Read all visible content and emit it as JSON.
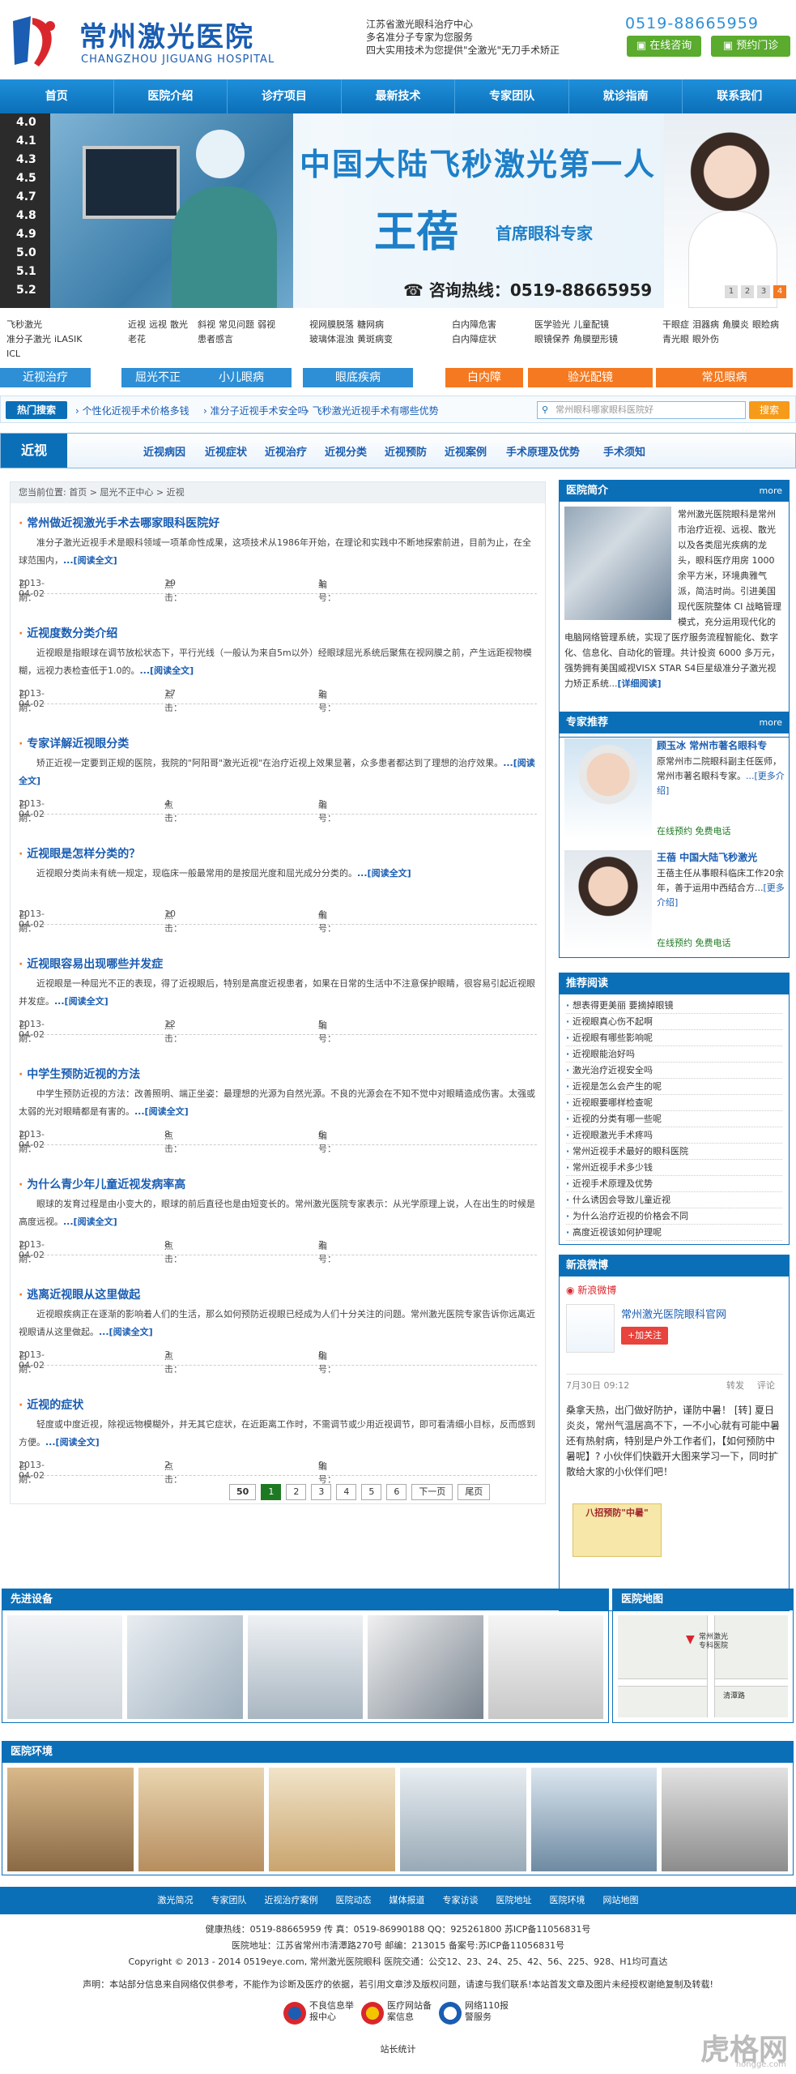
{
  "header": {
    "logo_cn": "常州激光医院",
    "logo_en": "CHANGZHOU JIGUANG HOSPITAL",
    "slogan": [
      "江苏省激光眼科治疗中心",
      "多名准分子专家为您服务",
      "四大实用技术为您提供\"全激光\"无刀手术矫正"
    ],
    "phone": "0519-88665959",
    "btn_consult": "在线咨询",
    "btn_booking": "预约门诊"
  },
  "nav": [
    "首页",
    "医院介绍",
    "诊疗项目",
    "最新技术",
    "专家团队",
    "就诊指南",
    "联系我们"
  ],
  "banner": {
    "eye_chart": [
      "4.0",
      "4.1",
      "4.3",
      "4.5",
      "4.7",
      "4.8",
      "4.9",
      "5.0",
      "5.1",
      "5.2"
    ],
    "headline": "中国大陆飞秒激光第一人",
    "name": "王蓓",
    "title": "首席眼科专家",
    "hotline": "咨询热线：0519-88665959",
    "dots": [
      "1",
      "2",
      "3",
      "4"
    ]
  },
  "categories": [
    {
      "links": [
        "飞秒激光",
        "准分子激光",
        "iLASIK",
        "ICL"
      ],
      "footer": "近视治疗",
      "color": "#2e8fd6"
    },
    {
      "links": [
        "近视",
        "远视",
        "散光",
        "老花"
      ],
      "footer": "屈光不正",
      "color": "#2e8fd6"
    },
    {
      "links": [
        "斜视",
        "常见问题",
        "弱视",
        "患者感言"
      ],
      "footer": "小儿眼病",
      "color": "#2e8fd6"
    },
    {
      "links": [
        "视网膜脱落",
        "糖网病",
        "玻璃体混浊",
        "黄斑病变"
      ],
      "footer": "眼底疾病",
      "color": "#2e8fd6"
    },
    {
      "links": [
        "白内障危害",
        "白内障症状"
      ],
      "footer": "白内障",
      "color": "#f47920"
    },
    {
      "links": [
        "医学验光",
        "儿童配镜",
        "眼镜保养",
        "角膜塑形镜"
      ],
      "footer": "验光配镜",
      "color": "#f47920"
    },
    {
      "links": [
        "干眼症",
        "泪器病",
        "角膜炎",
        "眼睑病",
        "青光眼",
        "眼外伤"
      ],
      "footer": "常见眼病",
      "color": "#f47920"
    }
  ],
  "hot": {
    "label": "热门搜索",
    "links": [
      "个性化近视手术价格多钱",
      "准分子近视手术安全吗",
      "飞秒激光近视手术有哪些优势"
    ],
    "placeholder": "常州眼科哪家眼科医院好",
    "btn": "搜索"
  },
  "subnav": {
    "title": "近视",
    "items": [
      "近视病因",
      "近视症状",
      "近视治疗",
      "近视分类",
      "近视预防",
      "近视案例",
      "手术原理及优势",
      "手术须知"
    ]
  },
  "breadcrumb": "您当前位置: 首页 > 屈光不正中心 > 近视",
  "labels": {
    "date": "日期：",
    "views": "点击：",
    "id": "编号：",
    "read": "...[阅读全文]"
  },
  "articles": [
    {
      "title": "常州做近视激光手术去哪家眼科医院好",
      "summary": "准分子激光近视手术是眼科领域一项革命性成果，这项技术从1986年开始，在理论和实践中不断地探索前进，目前为止，在全球范围内，",
      "date": "2013-04-02",
      "views": "19",
      "id": "1"
    },
    {
      "title": "近视度数分类介绍",
      "summary": "近视眼是指眼球在调节放松状态下，平行光线（一般认为来自5m以外）经眼球屈光系统后聚焦在视网膜之前，产生远距视物模糊，远视力表检查低于1.0的。",
      "date": "2013-04-02",
      "views": "17",
      "id": "2"
    },
    {
      "title": "专家详解近视眼分类",
      "summary": "矫正近视一定要到正规的医院，我院的\"阿阳哥\"激光近视\"在治疗近视上效果显著，众多患者都达到了理想的治疗效果。",
      "date": "2013-04-02",
      "views": "4",
      "id": "3"
    },
    {
      "title": "近视眼是怎样分类的？",
      "summary": "近视眼分类尚未有统一规定，现临床一般最常用的是按屈光度和屈光成分分类的。",
      "date": "2013-04-02",
      "views": "10",
      "id": "4"
    },
    {
      "title": "近视眼容易出现哪些并发症",
      "summary": "近视眼是一种屈光不正的表现，得了近视眼后，特别是高度近视患者，如果在日常的生活中不注意保护眼睛，很容易引起近视眼并发症。",
      "date": "2013-04-02",
      "views": "12",
      "id": "5"
    },
    {
      "title": "中学生预防近视的方法",
      "summary": "中学生预防近视的方法：改善照明、端正坐姿：最理想的光源为自然光源。不良的光源会在不知不觉中对眼睛造成伤害。太强或太弱的光对眼睛都是有害的。",
      "date": "2013-04-02",
      "views": "8",
      "id": "6"
    },
    {
      "title": "为什么青少年儿童近视发病率高",
      "summary": "眼球的发育过程是由小变大的，眼球的前后直径也是由短变长的。常州激光医院专家表示：从光学原理上说，人在出生的时候是高度远视。",
      "date": "2013-04-02",
      "views": "8",
      "id": "7"
    },
    {
      "title": "逃离近视眼从这里做起",
      "summary": "近视眼疾病正在逐渐的影响着人们的生活，那么如何预防近视眼已经成为人们十分关注的问题。常州激光医院专家告诉你远离近视眼请从这里做起。",
      "date": "2013-04-02",
      "views": "3",
      "id": "8"
    },
    {
      "title": "近视的症状",
      "summary": "轻度或中度近视，除视远物模糊外，并无其它症状，在近距离工作时，不需调节或少用近视调节，即可看清细小目标，反而感到方便。",
      "date": "2013-04-02",
      "views": "2",
      "id": "9"
    }
  ],
  "pager": [
    "50",
    "1",
    "2",
    "3",
    "4",
    "5",
    "6",
    "下一页",
    "尾页"
  ],
  "sidebar": {
    "intro_title": "医院简介",
    "more": "more",
    "intro_text": "常州激光医院眼科是常州市治疗近视、远视、散光以及各类屈光疾病的龙头，眼科医疗用房 1000 余平方米，环境典雅气派，简洁时尚。引进美国现代医院整体 CI 战略管理模式，充分运用现代化的电脑网络管理系统，实现了医疗服务流程智能化、数字化、信息化、自动化的管理。共计投资 6000 多万元，强势拥有美国威视VISX STAR S4巨星级准分子激光视力矫正系统...",
    "intro_more": "[详细阅读]",
    "experts_title": "专家推荐",
    "experts": [
      {
        "name": "顾玉冰 常州市著名眼科专",
        "desc": "原常州市二院眼科副主任医师，常州市著名眼科专家。",
        "more": "...[更多介绍]",
        "consult": "在线预约 免费电话"
      },
      {
        "name": "王蓓 中国大陆飞秒激光",
        "desc": "王蓓主任从事眼科临床工作20余年，善于运用中西结合方...",
        "more": "[更多介绍]",
        "consult": "在线预约 免费电话"
      }
    ],
    "reading_title": "推荐阅读",
    "reading": [
      "想表得更美丽 要摘掉眼镜",
      "近视眼真心伤不起啊",
      "近视眼有哪些影响呢",
      "近视眼能治好吗",
      "激光治疗近视安全吗",
      "近视是怎么会产生的呢",
      "近视眼要哪样检查呢",
      "近视的分类有哪一些呢",
      "近视眼激光手术疼吗",
      "常州近视手术最好的眼科医院",
      "常州近视手术多少钱",
      "近视手术原理及优势",
      "什么诱因会导致儿童近视",
      "为什么治疗近视的价格会不同",
      "高度近视该如何护理呢"
    ],
    "weibo_title": "新浪微博",
    "weibo_brand": "新浪微博",
    "weibo_account": "常州激光医院眼科官网",
    "weibo_follow": "+加关注",
    "weibo_date": "7月30日 09:12",
    "weibo_forward": "转发",
    "weibo_comment": "评论",
    "weibo_text": "桑拿天热，出门做好防护，谨防中暑！ [转] 夏日炎炎，常州气温居高不下，一不小心就有可能中暑还有热射病，特别是户外工作者们，【如何预防中暑呢】? 小伙伴们快戳开大图来学习一下，同时扩散给大家的小伙伴们吧！",
    "weibo_poster": "八招预防\"中暑\""
  },
  "equip_title": "先进设备",
  "map_title": "医院地图",
  "map_labels": [
    "常州激光",
    "专科医院",
    "清潭路"
  ],
  "env_title": "医院环境",
  "footer": {
    "nav": [
      "激光简况",
      "专家团队",
      "近视治疗案例",
      "医院动态",
      "媒体报道",
      "专家访谈",
      "医院地址",
      "医院环境",
      "网站地图"
    ],
    "line1": "健康热线：0519-88665959 传 真：0519-86990188 QQ：925261800 苏ICP备11056831号",
    "line2": "医院地址：江苏省常州市清潭路270号 邮编：213015 备案号:苏ICP备11056831号",
    "line3": "Copyright © 2013 - 2014 0519eye.com, 常州激光医院眼科 医院交通：公交12、23、24、25、42、56、225、928、H1均可直达",
    "line4": "声明：本站部分信息来自网络仅供参考，不能作为诊断及医疗的依据，若引用文章涉及版权问题，请速与我们联系!本站首发文章及图片未经授权谢绝复制及转载!",
    "badges": [
      "不良信息举报中心",
      "医疗网站备案信息",
      "网络110报警服务"
    ],
    "stats": "站长统计"
  },
  "watermark": "虎格网",
  "watermark_url": "hongge.com"
}
